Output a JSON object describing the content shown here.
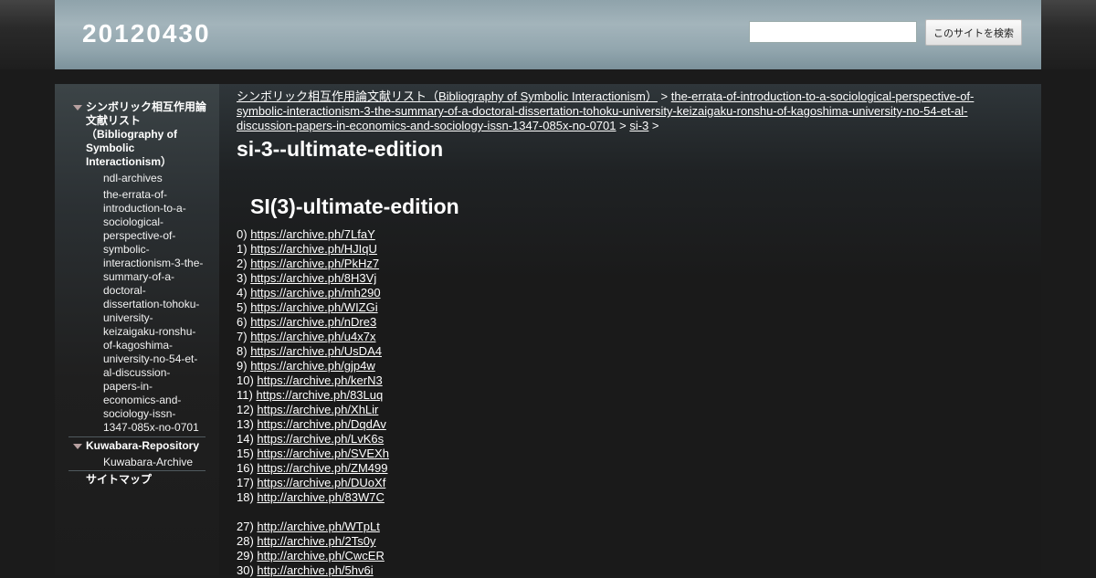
{
  "site": {
    "title": "20120430",
    "search_button": "このサイトを検索",
    "search_value": ""
  },
  "sidebar": {
    "section1": {
      "title": "シンボリック相互作用論文献リスト（Bibliography of Symbolic Interactionism）",
      "children": [
        "ndl-archives",
        "the-errata-of-introduction-to-a-sociological-perspective-of-symbolic-interactionism-3-the-summary-of-a-doctoral-dissertation-tohoku-university-keizaigaku-ronshu-of-kagoshima-university-no-54-et-al-discussion-papers-in-economics-and-sociology-issn-1347-085x-no-0701"
      ]
    },
    "section2": {
      "title": "Kuwabara-Repository",
      "children": [
        "Kuwabara-Archive"
      ]
    },
    "sitemap": "サイトマップ"
  },
  "breadcrumb": {
    "item1": "シンボリック相互作用論文献リスト（Bibliography of Symbolic Interactionism）",
    "item2": "the-errata-of-introduction-to-a-sociological-perspective-of-symbolic-interactionism-3-the-summary-of-a-doctoral-dissertation-tohoku-university-keizaigaku-ronshu-of-kagoshima-university-no-54-et-al-discussion-papers-in-economics-and-sociology-issn-1347-085x-no-0701",
    "item3": "si-3",
    "separator": ">"
  },
  "page": {
    "title": "si-3--ultimate-edition",
    "heading": "SI(3)-ultimate-edition"
  },
  "links": [
    {
      "num": "0)",
      "url": "https://archive.ph/7LfaY"
    },
    {
      "num": "1)",
      "url": "https://archive.ph/HJIqU"
    },
    {
      "num": "2)",
      "url": "https://archive.ph/PkHz7"
    },
    {
      "num": "3)",
      "url": "https://archive.ph/8H3Vj"
    },
    {
      "num": "4)",
      "url": "https://archive.ph/mh290"
    },
    {
      "num": "5)",
      "url": "https://archive.ph/WIZGi"
    },
    {
      "num": "6)",
      "url": "https://archive.ph/nDre3"
    },
    {
      "num": "7)",
      "url": "https://archive.ph/u4x7x"
    },
    {
      "num": "8)",
      "url": "https://archive.ph/UsDA4"
    },
    {
      "num": "9)",
      "url": "https://archive.ph/gjp4w"
    },
    {
      "num": "10)",
      "url": "https://archive.ph/kerN3"
    },
    {
      "num": "11)",
      "url": "https://archive.ph/83Luq"
    },
    {
      "num": "12)",
      "url": "https://archive.ph/XhLir"
    },
    {
      "num": "13)",
      "url": "https://archive.ph/DqdAv"
    },
    {
      "num": "14)",
      "url": "https://archive.ph/LvK6s"
    },
    {
      "num": "15)",
      "url": "https://archive.ph/SVEXh"
    },
    {
      "num": "16)",
      "url": "https://archive.ph/ZM499"
    },
    {
      "num": "17)",
      "url": "https://archive.ph/DUoXf"
    },
    {
      "num": "18)",
      "url": "http://archive.ph/83W7C"
    }
  ],
  "links2": [
    {
      "num": "27)",
      "url": "http://archive.ph/WTpLt"
    },
    {
      "num": "28)",
      "url": "http://archive.ph/2Ts0y"
    },
    {
      "num": "29)",
      "url": "http://archive.ph/CwcER"
    },
    {
      "num": "30)",
      "url": "http://archive.ph/5hv6i"
    }
  ]
}
